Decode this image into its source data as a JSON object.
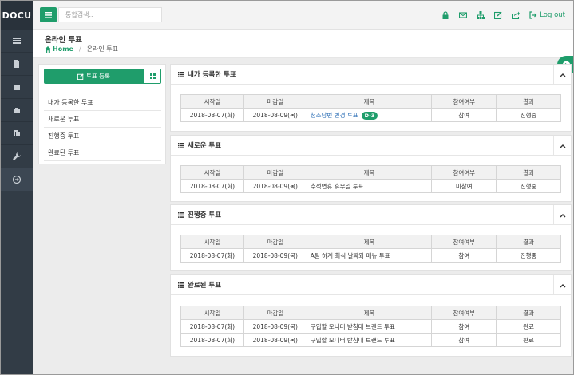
{
  "app": {
    "logo": "DOCU"
  },
  "topbar": {
    "search_placeholder": "통합검색..",
    "logout_label": "Log out"
  },
  "page": {
    "title": "온라인 투표",
    "breadcrumb_home": "Home",
    "breadcrumb_current": "온라인 투표"
  },
  "left": {
    "register_label": "투표 등록",
    "items": [
      "내가 등록한 투표",
      "새로운 투표",
      "진행중 투표",
      "완료된 투표"
    ]
  },
  "columns": [
    "시작일",
    "마감일",
    "제목",
    "참여여부",
    "결과"
  ],
  "panels": [
    {
      "title": "내가 등록한 투표",
      "rows": [
        {
          "start": "2018-08-07(화)",
          "end": "2018-08-09(목)",
          "title": "청소당번 변경 투표",
          "badge": "D-3",
          "joined": "참여",
          "result": "진행중"
        }
      ]
    },
    {
      "title": "새로운 투표",
      "rows": [
        {
          "start": "2018-08-07(화)",
          "end": "2018-08-09(목)",
          "title": "추석연휴 휴무일 투표",
          "joined": "미참여",
          "result": "진행중"
        }
      ]
    },
    {
      "title": "진행중 투표",
      "rows": [
        {
          "start": "2018-08-07(화)",
          "end": "2018-08-09(목)",
          "title": "A팀 하계 회식 날짜와 메뉴 투표",
          "joined": "참여",
          "result": "진행중"
        }
      ]
    },
    {
      "title": "완료된 투표",
      "rows": [
        {
          "start": "2018-08-07(화)",
          "end": "2018-08-09(목)",
          "title": "구입할 모니터 받침대 브랜드 투표",
          "joined": "참여",
          "result": "완료"
        },
        {
          "start": "2018-08-07(화)",
          "end": "2018-08-09(목)",
          "title": "구입할 모니터 받침대 브랜드 투표",
          "joined": "참여",
          "result": "완료"
        }
      ]
    }
  ],
  "colors": {
    "accent": "#1f9d6b",
    "sidebar": "#323c46",
    "link": "#2a6db5"
  }
}
